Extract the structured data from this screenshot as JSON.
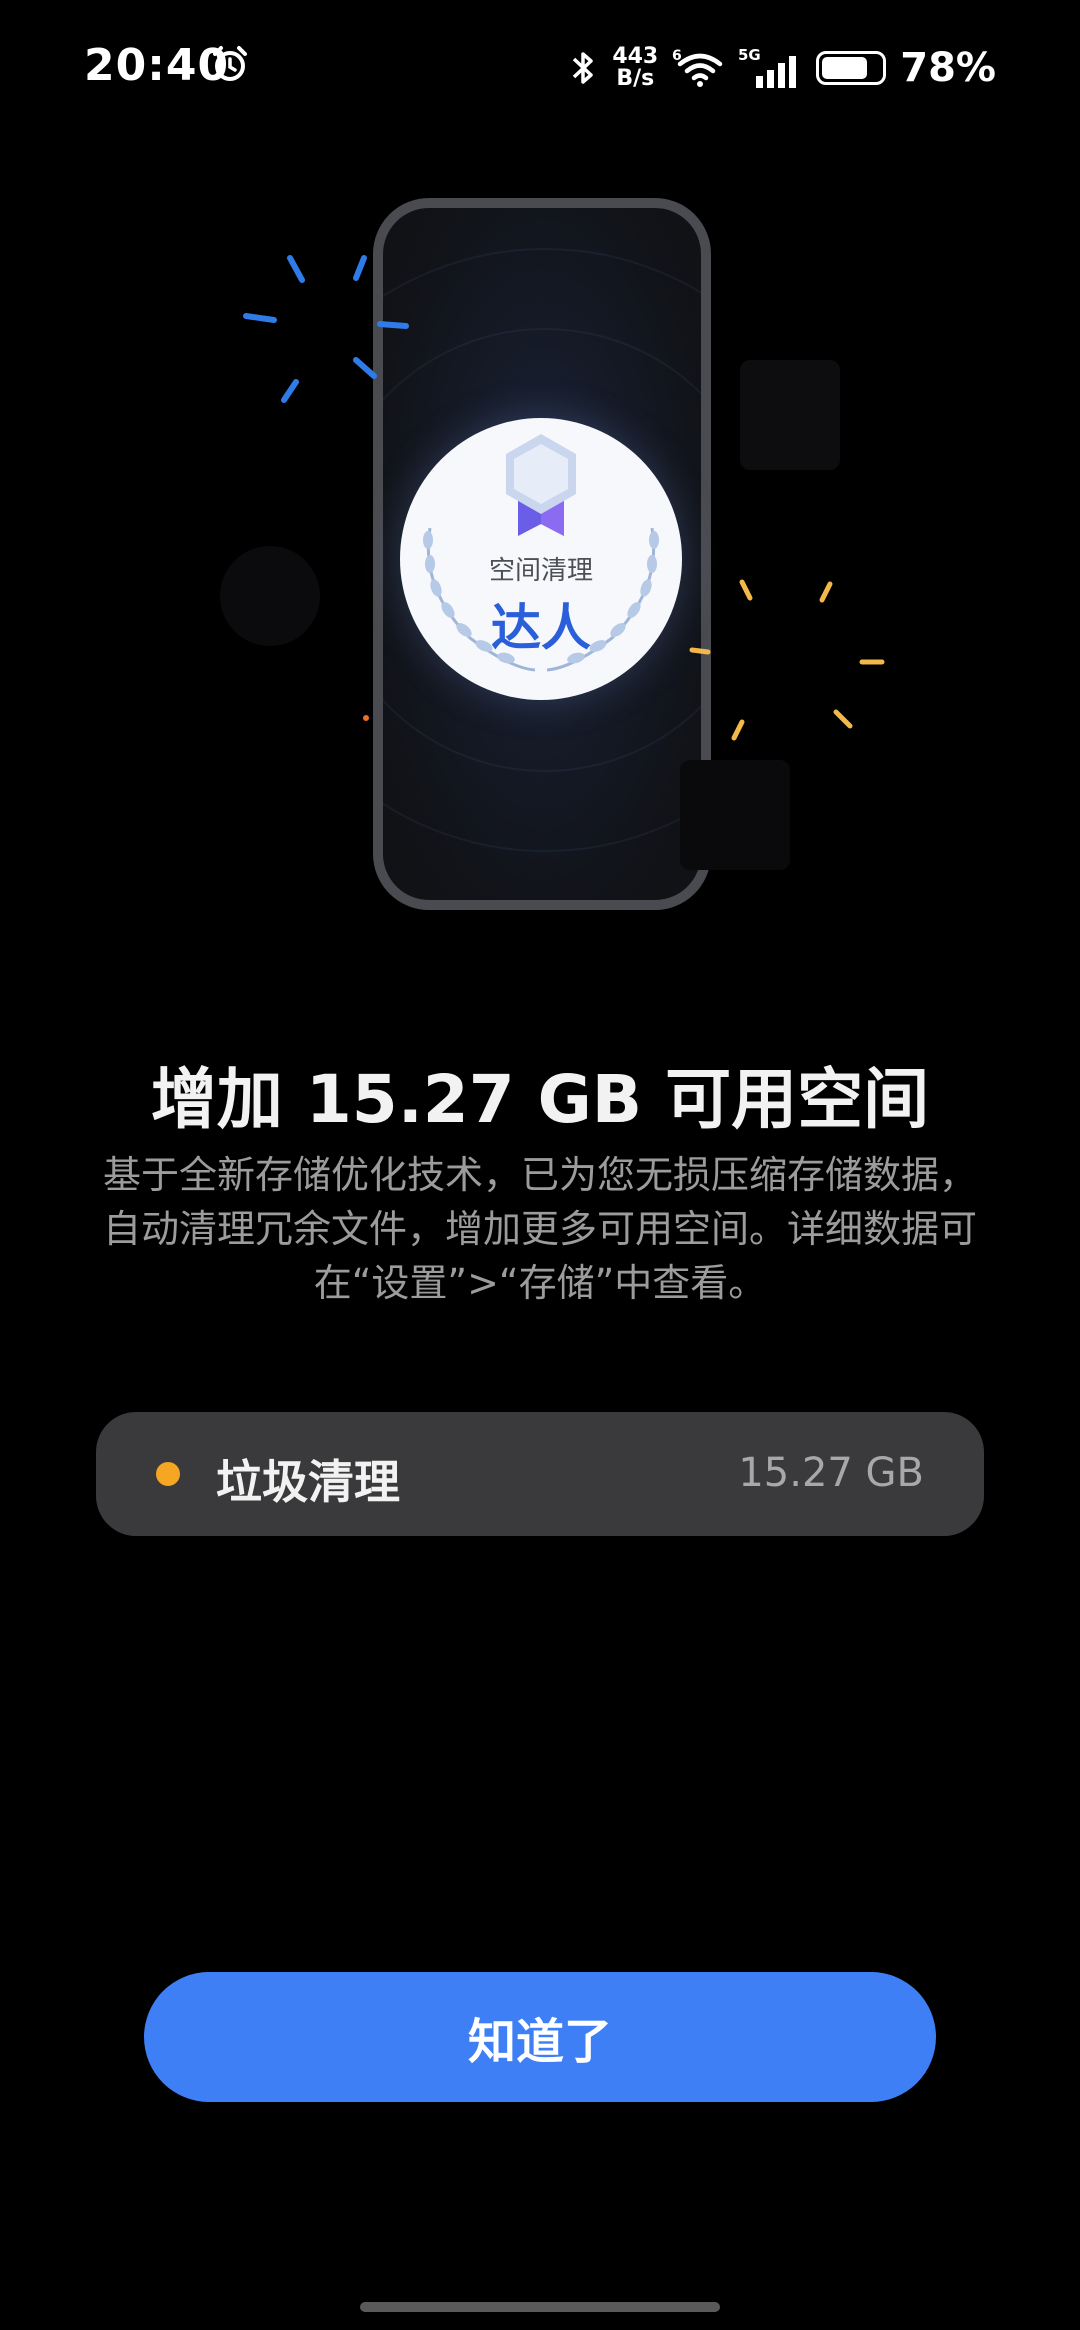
{
  "status_bar": {
    "time": "20:40",
    "net_speed_value": "443",
    "net_speed_unit": "B/s",
    "network_type": "5G",
    "wifi_badge": "6",
    "battery_percent": "78%",
    "battery_level": 0.78,
    "icons": [
      "alarm-icon",
      "bluetooth-icon",
      "wifi-icon",
      "signal-icon",
      "battery-icon"
    ]
  },
  "badge": {
    "top_text": "空间清理",
    "main_text": "达人"
  },
  "headline": "增加 15.27 GB 可用空间",
  "description": "基于全新存储优化技术，已为您无损压缩存储数据，自动清理冗余文件，增加更多可用空间。详细数据可在“设置”>“存储”中查看。",
  "items": [
    {
      "label": "垃圾清理",
      "value": "15.27 GB",
      "dot_color": "#f5a623"
    }
  ],
  "confirm_button": {
    "label": "知道了"
  },
  "colors": {
    "background": "#000000",
    "accent": "#3f7ff6",
    "card": "#3a3a3c",
    "badge_text": "#2b5fd9"
  }
}
